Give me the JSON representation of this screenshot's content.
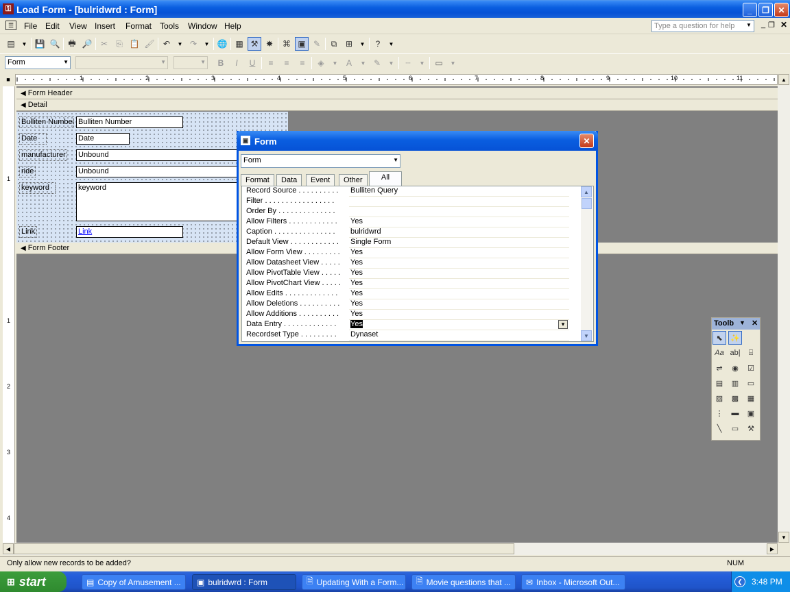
{
  "window": {
    "title": "Load Form - [bulridwrd : Form]"
  },
  "menu": {
    "items": [
      "File",
      "Edit",
      "View",
      "Insert",
      "Format",
      "Tools",
      "Window",
      "Help"
    ],
    "ask_placeholder": "Type a question for help"
  },
  "format_toolbar": {
    "object_selector": "Form",
    "font": "",
    "size": ""
  },
  "ruler": {
    "marks": [
      "1",
      "2",
      "3",
      "4",
      "5",
      "6",
      "7",
      "8",
      "9",
      "10",
      "11"
    ]
  },
  "vruler": {
    "marks": [
      "1",
      "1",
      "2",
      "3",
      "4"
    ]
  },
  "sections": {
    "header": "Form Header",
    "detail": "Detail",
    "footer": "Form Footer"
  },
  "fields": [
    {
      "label": "Bulliten Number",
      "control": "Bulliten Number"
    },
    {
      "label": "Date",
      "control": "Date"
    },
    {
      "label": "manufacturer",
      "control": "Unbound"
    },
    {
      "label": "ride",
      "control": "Unbound"
    },
    {
      "label": "keyword",
      "control": "keyword"
    },
    {
      "label": "Link",
      "control": "Link"
    }
  ],
  "property_sheet": {
    "title": "Form",
    "selector": "Form",
    "tabs": [
      "Format",
      "Data",
      "Event",
      "Other",
      "All"
    ],
    "active_tab": "All",
    "properties": [
      {
        "name": "Record Source . . . . . . . . . .",
        "value": "Bulliten Query"
      },
      {
        "name": "Filter . . . . . . . . . . . . . . . . .",
        "value": ""
      },
      {
        "name": "Order By . . . . . . . . . . . . . .",
        "value": ""
      },
      {
        "name": "Allow Filters . . . . . . . . . . . .",
        "value": "Yes"
      },
      {
        "name": "Caption . . . . . . . . . . . . . . .",
        "value": "bulridwrd"
      },
      {
        "name": "Default View . . . . . . . . . . . .",
        "value": "Single Form"
      },
      {
        "name": "Allow Form View . . . . . . . . .",
        "value": "Yes"
      },
      {
        "name": "Allow Datasheet View . . . . .",
        "value": "Yes"
      },
      {
        "name": "Allow PivotTable View . . . . .",
        "value": "Yes"
      },
      {
        "name": "Allow PivotChart View . . . . .",
        "value": "Yes"
      },
      {
        "name": "Allow Edits . . . . . . . . . . . . .",
        "value": "Yes"
      },
      {
        "name": "Allow Deletions . . . . . . . . . .",
        "value": "Yes"
      },
      {
        "name": "Allow Additions . . . . . . . . . .",
        "value": "Yes"
      },
      {
        "name": "Data Entry . . . . . . . . . . . . .",
        "value": "Yes"
      },
      {
        "name": "Recordset Type . . . . . . . . .",
        "value": "Dynaset"
      }
    ]
  },
  "toolbox": {
    "title": "Toolb"
  },
  "status": {
    "text": "Only allow new records to be added?",
    "num": "NUM"
  },
  "taskbar": {
    "start": "start",
    "tasks": [
      "Copy of Amusement ...",
      "bulridwrd : Form",
      "Updating With a Form...",
      "Movie questions that ...",
      "Inbox - Microsoft Out..."
    ],
    "clock": "3:48 PM"
  }
}
